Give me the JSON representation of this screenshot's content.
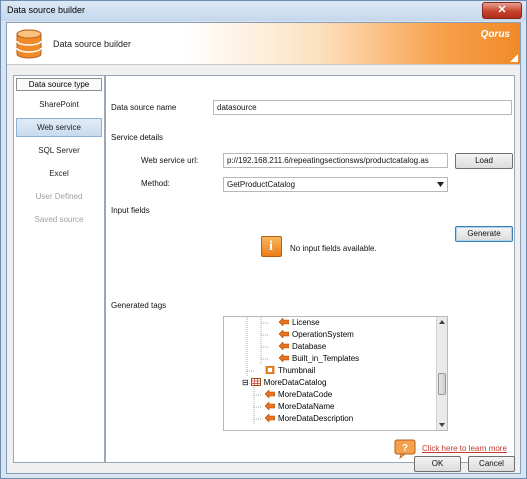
{
  "window": {
    "title": "Data source builder",
    "close_glyph": "✕"
  },
  "banner": {
    "title": "Data source builder",
    "brand": "Qorus",
    "icon": "database-icon"
  },
  "nav": {
    "header": "Data source type",
    "items": [
      {
        "label": "SharePoint",
        "state": "normal"
      },
      {
        "label": "Web service",
        "state": "selected"
      },
      {
        "label": "SQL Server",
        "state": "normal"
      },
      {
        "label": "Excel",
        "state": "normal"
      },
      {
        "label": "User Defined",
        "state": "disabled"
      },
      {
        "label": "Saved source",
        "state": "disabled"
      }
    ]
  },
  "form": {
    "datasource_name_label": "Data source name",
    "datasource_name_value": "datasource",
    "service_details_label": "Service details",
    "web_service_url_label": "Web service url:",
    "web_service_url_value": "p://192.168.211.6/repeatingsectionsws/productcatalog.as",
    "load_label": "Load",
    "method_label": "Method:",
    "method_value": "GetProductCatalog",
    "input_fields_label": "Input fields",
    "generate_label": "Generate",
    "no_input_text": "No input fields available.",
    "generated_tags_label": "Generated tags"
  },
  "tree": {
    "rows": [
      {
        "label": "License",
        "icon": "field-arrow-icon"
      },
      {
        "label": "OperationSystem",
        "icon": "field-arrow-icon"
      },
      {
        "label": "Database",
        "icon": "field-arrow-icon"
      },
      {
        "label": "Built_in_Templates",
        "icon": "field-arrow-icon"
      },
      {
        "label": "Thumbnail",
        "icon": "image-field-icon"
      },
      {
        "label": "MoreDataCatalog",
        "icon": "table-icon",
        "expander": "⊟"
      },
      {
        "label": "MoreDataCode",
        "icon": "field-arrow-icon"
      },
      {
        "label": "MoreDataName",
        "icon": "field-arrow-icon"
      },
      {
        "label": "MoreDataDescription",
        "icon": "field-arrow-icon"
      }
    ]
  },
  "help": {
    "link_text": "Click here to learn more",
    "icon": "help-icon"
  },
  "buttons": {
    "ok_label": "OK",
    "cancel_label": "Cancel"
  },
  "colors": {
    "accent_orange": "#f08a28",
    "selection_blue": "#c8daee",
    "link_red": "#c0392b"
  }
}
